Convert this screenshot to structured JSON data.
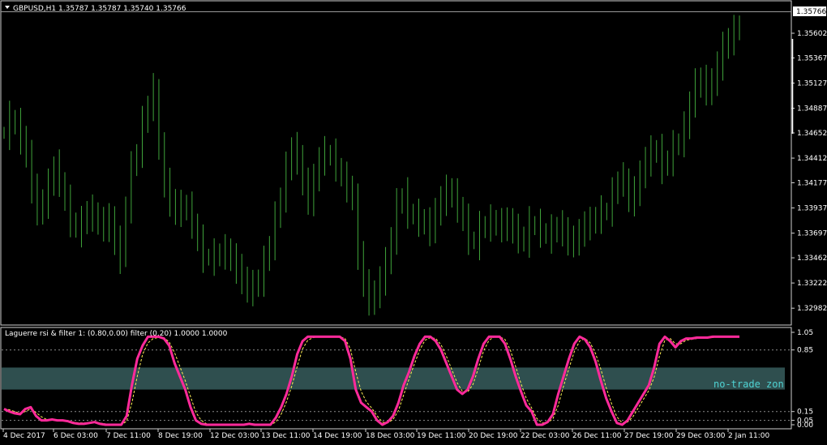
{
  "main": {
    "header": {
      "collapse_icon": "triangle-down-icon",
      "title": "GBPUSD,H1  1.35787 1.35787 1.35740 1.35766"
    },
    "price_badge": "1.35766"
  },
  "sub": {
    "header": "Laguerre rsi & filter 1: (0.80,0.00) filter (0.20) 1.0000 1.0000",
    "zone_label": "no-trade zon"
  },
  "chart_data": [
    {
      "type": "bar",
      "title": "GBPUSD,H1",
      "ohlc": {
        "open": 1.35787,
        "high": 1.35787,
        "low": 1.3574,
        "close": 1.35766
      },
      "last_price": 1.35766,
      "ylim": [
        1.3286,
        1.3588
      ],
      "y_ticks": [
        "1.35766",
        "1.35602",
        "1.35367",
        "1.35127",
        "1.34887",
        "1.34652",
        "1.34412",
        "1.34177",
        "1.33937",
        "1.33697",
        "1.33462",
        "1.33222",
        "1.32982"
      ],
      "x_ticks": [
        "4 Dec 2017",
        "6 Dec 03:00",
        "7 Dec 11:00",
        "8 Dec 19:00",
        "12 Dec 03:00",
        "13 Dec 11:00",
        "14 Dec 19:00",
        "18 Dec 03:00",
        "19 Dec 11:00",
        "20 Dec 19:00",
        "22 Dec 03:00",
        "26 Dec 11:00",
        "27 Dec 19:00",
        "29 Dec 03:00",
        "2 Jan 11:00"
      ],
      "bar_color": "#3fa33a",
      "close_series": [
        1.3465,
        1.3478,
        1.3472,
        1.346,
        1.3443,
        1.3412,
        1.339,
        1.3398,
        1.3415,
        1.3432,
        1.342,
        1.3398,
        1.3382,
        1.3372,
        1.3378,
        1.339,
        1.3386,
        1.338,
        1.3375,
        1.3383,
        1.336,
        1.3346,
        1.3395,
        1.343,
        1.3448,
        1.3473,
        1.3492,
        1.3505,
        1.345,
        1.3418,
        1.3398,
        1.339,
        1.3395,
        1.3392,
        1.338,
        1.336,
        1.3348,
        1.3345,
        1.3347,
        1.335,
        1.3352,
        1.3345,
        1.3335,
        1.3325,
        1.3315,
        1.3318,
        1.3325,
        1.334,
        1.336,
        1.3382,
        1.3405,
        1.343,
        1.345,
        1.344,
        1.3418,
        1.34,
        1.342,
        1.344,
        1.3445,
        1.3442,
        1.3435,
        1.342,
        1.3415,
        1.34,
        1.335,
        1.332,
        1.3305,
        1.331,
        1.3325,
        1.334,
        1.3365,
        1.3395,
        1.3405,
        1.339,
        1.3385,
        1.3382,
        1.3378,
        1.3372,
        1.339,
        1.34,
        1.341,
        1.3405,
        1.3395,
        1.338,
        1.3365,
        1.336,
        1.3373,
        1.3377,
        1.338,
        1.3378,
        1.3375,
        1.338,
        1.3372,
        1.3365,
        1.3362,
        1.3378,
        1.3375,
        1.3372,
        1.3366,
        1.337,
        1.3375,
        1.3372,
        1.336,
        1.3362,
        1.3368,
        1.3378,
        1.3378,
        1.3385,
        1.3388,
        1.3392,
        1.3405,
        1.342,
        1.342,
        1.34,
        1.3408,
        1.3425,
        1.3438,
        1.3447,
        1.3447,
        1.3432,
        1.344,
        1.345,
        1.3458,
        1.3468,
        1.3495,
        1.351,
        1.3515,
        1.3505,
        1.3512,
        1.353,
        1.3545,
        1.3555,
        1.356,
        1.357
      ]
    },
    {
      "type": "line",
      "title": "Laguerre rsi & filter 1",
      "ylim": [
        0,
        1.05
      ],
      "y_ticks": [
        "1.05",
        "0.85",
        "0.15",
        "0.05",
        "0.00"
      ],
      "levels": [
        0.85,
        0.15,
        0.05
      ],
      "no_trade_zone": [
        0.4,
        0.65
      ],
      "series": [
        {
          "color": "#ff2a9a",
          "values": [
            0.18,
            0.15,
            0.13,
            0.12,
            0.18,
            0.2,
            0.1,
            0.05,
            0.05,
            0.06,
            0.05,
            0.05,
            0.04,
            0.02,
            0.01,
            0.01,
            0.02,
            0.03,
            0.01,
            0.0,
            0.0,
            0.0,
            0.0,
            0.1,
            0.45,
            0.75,
            0.9,
            1.0,
            1.0,
            1.0,
            0.98,
            0.9,
            0.7,
            0.55,
            0.4,
            0.2,
            0.05,
            0.01,
            0.0,
            0.0,
            0.0,
            0.0,
            0.0,
            0.0,
            0.0,
            0.0,
            0.01,
            0.0,
            0.0,
            0.0,
            0.0,
            0.08,
            0.2,
            0.35,
            0.55,
            0.8,
            0.95,
            1.0,
            1.0,
            1.0,
            1.0,
            1.0,
            1.0,
            1.0,
            0.95,
            0.75,
            0.4,
            0.25,
            0.2,
            0.15,
            0.05,
            0.0,
            0.03,
            0.1,
            0.25,
            0.45,
            0.6,
            0.78,
            0.92,
            1.0,
            1.0,
            0.95,
            0.85,
            0.7,
            0.55,
            0.4,
            0.35,
            0.4,
            0.55,
            0.75,
            0.92,
            1.0,
            1.0,
            1.0,
            0.92,
            0.75,
            0.55,
            0.38,
            0.22,
            0.15,
            0.0,
            0.0,
            0.03,
            0.12,
            0.35,
            0.55,
            0.75,
            0.92,
            1.0,
            0.97,
            0.88,
            0.72,
            0.5,
            0.3,
            0.15,
            0.02,
            0.0,
            0.05,
            0.15,
            0.25,
            0.35,
            0.45,
            0.65,
            0.92,
            1.0,
            0.95,
            0.88,
            0.95,
            0.98,
            0.98,
            0.99,
            0.99,
            0.99,
            1.0,
            1.0,
            1.0,
            1.0,
            1.0,
            1.0
          ]
        },
        {
          "color": "#ffee55",
          "style": "dashed",
          "values": [
            0.18,
            0.17,
            0.15,
            0.13,
            0.15,
            0.18,
            0.14,
            0.09,
            0.06,
            0.06,
            0.05,
            0.05,
            0.04,
            0.03,
            0.02,
            0.02,
            0.02,
            0.03,
            0.02,
            0.01,
            0.0,
            0.0,
            0.0,
            0.04,
            0.25,
            0.55,
            0.8,
            0.93,
            0.98,
            0.99,
            0.99,
            0.94,
            0.82,
            0.66,
            0.5,
            0.32,
            0.14,
            0.05,
            0.01,
            0.0,
            0.0,
            0.0,
            0.0,
            0.0,
            0.0,
            0.0,
            0.0,
            0.01,
            0.0,
            0.0,
            0.0,
            0.03,
            0.12,
            0.26,
            0.44,
            0.66,
            0.86,
            0.96,
            0.99,
            1.0,
            1.0,
            1.0,
            1.0,
            1.0,
            0.98,
            0.86,
            0.6,
            0.38,
            0.26,
            0.19,
            0.1,
            0.03,
            0.02,
            0.06,
            0.16,
            0.34,
            0.52,
            0.69,
            0.85,
            0.96,
            0.99,
            0.98,
            0.91,
            0.78,
            0.63,
            0.48,
            0.38,
            0.37,
            0.46,
            0.64,
            0.84,
            0.96,
            1.0,
            1.0,
            0.97,
            0.85,
            0.66,
            0.47,
            0.3,
            0.19,
            0.07,
            0.02,
            0.02,
            0.07,
            0.22,
            0.44,
            0.64,
            0.83,
            0.95,
            0.98,
            0.93,
            0.81,
            0.63,
            0.42,
            0.24,
            0.09,
            0.02,
            0.03,
            0.09,
            0.19,
            0.29,
            0.39,
            0.54,
            0.78,
            0.96,
            0.98,
            0.92,
            0.92,
            0.96,
            0.97,
            0.98,
            0.99,
            0.99,
            0.99,
            1.0,
            1.0,
            1.0,
            1.0,
            1.0
          ]
        }
      ]
    }
  ]
}
